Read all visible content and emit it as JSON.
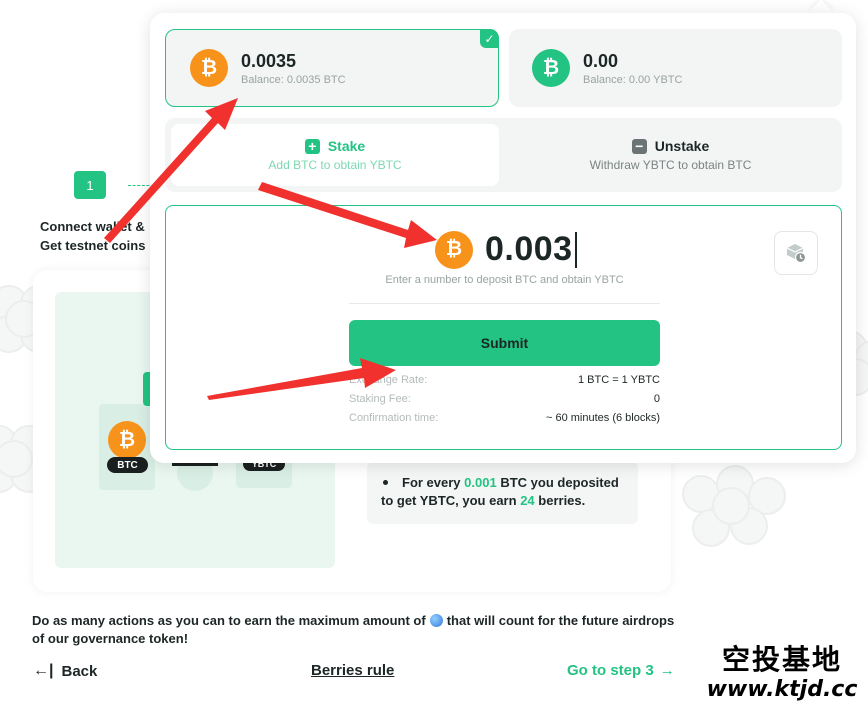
{
  "background": {
    "step_number": "1",
    "step_label": "Connect wallet &\nGet testnet coins",
    "btc_pill": "BTC",
    "ybtc_pill": "YBTC",
    "reward": {
      "prefix": "For every",
      "amount": "0.001",
      "middle": "BTC you deposited to get YBTC, you earn",
      "count": "24",
      "suffix": "berries."
    }
  },
  "footer": {
    "text_before": "Do as many actions as you can to earn the maximum amount of",
    "text_after": "that will count for the future airdrops of our governance token!",
    "back_label": "Back",
    "berries_rule_label": "Berries rule",
    "next_label": "Go to step 3"
  },
  "watermark": {
    "cn": "空投基地",
    "url": "www.ktjd.cc"
  },
  "popup": {
    "tokens": [
      {
        "symbol_icon": "bitcoin-icon",
        "amount": "0.0035",
        "balance": "Balance: 0.0035 BTC",
        "selected": true
      },
      {
        "symbol_icon": "ybtc-icon",
        "amount": "0.00",
        "balance": "Balance: 0.00 YBTC",
        "selected": false
      }
    ],
    "modes": {
      "stake": {
        "title": "Stake",
        "subtitle": "Add BTC to obtain YBTC"
      },
      "unstake": {
        "title": "Unstake",
        "subtitle": "Withdraw YBTC to obtain BTC"
      }
    },
    "form": {
      "amount": "0.003",
      "hint": "Enter a number to deposit BTC and obtain YBTC",
      "submit_label": "Submit",
      "info": [
        {
          "label": "Exchange Rate:",
          "value": "1 BTC = 1 YBTC"
        },
        {
          "label": "Staking Fee:",
          "value": "0"
        },
        {
          "label": "Confirmation time:",
          "value": "~ 60 minutes (6 blocks)"
        }
      ]
    }
  },
  "colors": {
    "accent": "#22c383",
    "btc": "#f7931a",
    "annotation_arrow": "#f0312e"
  }
}
